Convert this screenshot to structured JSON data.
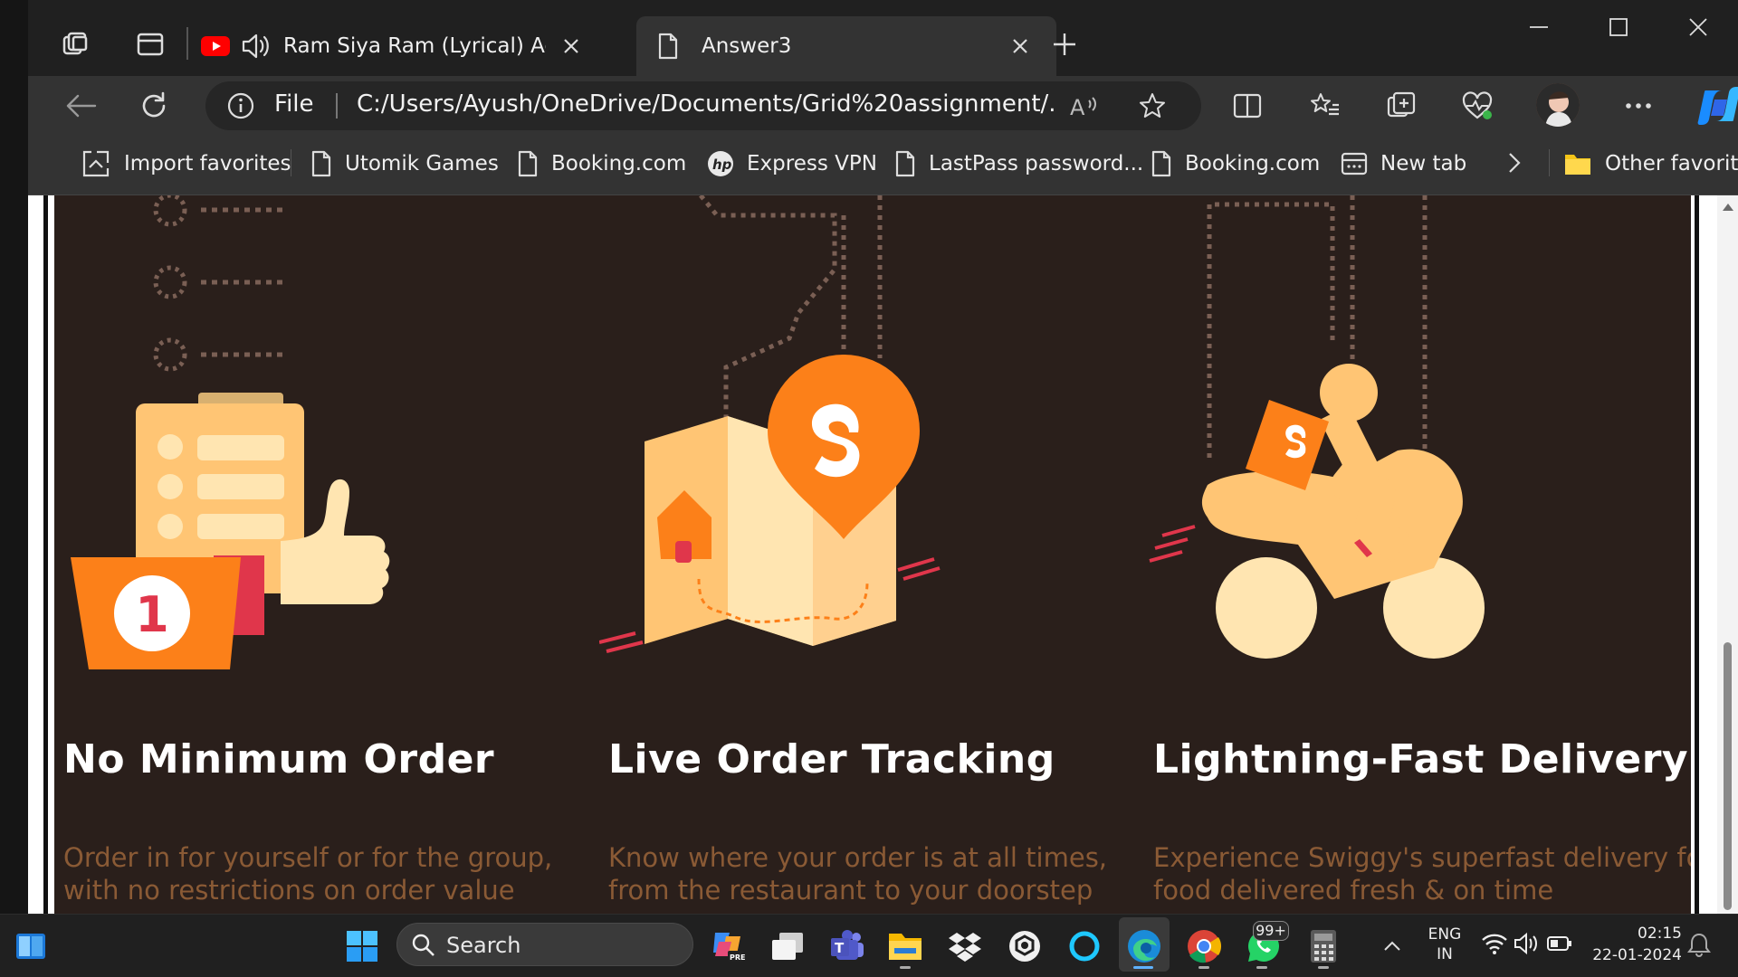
{
  "browser": {
    "tabs": [
      {
        "title": "Ram Siya Ram (Lyrical) Adip",
        "icon": "youtube-icon",
        "audio": true,
        "active": false
      },
      {
        "title": "Answer3",
        "icon": "document-icon",
        "active": true
      }
    ],
    "address": {
      "scheme_label": "File",
      "url": "C:/Users/Ayush/OneDrive/Documents/Grid%20assignment/..."
    },
    "favorites": [
      {
        "label": "Import favorites",
        "icon": "import-icon"
      },
      {
        "label": "Utomik Games",
        "icon": "page-icon"
      },
      {
        "label": "Booking.com",
        "icon": "page-icon"
      },
      {
        "label": "Express VPN",
        "icon": "hp-icon"
      },
      {
        "label": "LastPass password...",
        "icon": "page-icon"
      },
      {
        "label": "Booking.com",
        "icon": "page-icon"
      },
      {
        "label": "New tab",
        "icon": "newtab-icon"
      }
    ],
    "other_favorites": "Other favorites"
  },
  "content": {
    "features": [
      {
        "title": "No Minimum Order",
        "desc": [
          "Order in for yourself or for the group,",
          "with no restrictions on order value"
        ],
        "illustration": "clipboard-thumbs-up"
      },
      {
        "title": "Live Order Tracking",
        "desc": [
          "Know where your order is at all times,",
          "from the restaurant to your doorstep"
        ],
        "illustration": "map-pin"
      },
      {
        "title": "Lightning-Fast Delivery",
        "desc": [
          "Experience Swiggy's superfast delivery for",
          "food delivered fresh & on time"
        ],
        "illustration": "delivery-scooter"
      }
    ],
    "badge_number": "1",
    "colors": {
      "background": "#2a1f1b",
      "accent": "#fc8019",
      "illustration_light": "#ffc574",
      "desc_text": "#8a5a35"
    }
  },
  "taskbar": {
    "search_placeholder": "Search",
    "whatsapp_badge": "99+",
    "language_line1": "ENG",
    "language_line2": "IN",
    "time": "02:15",
    "date": "22-01-2024"
  }
}
